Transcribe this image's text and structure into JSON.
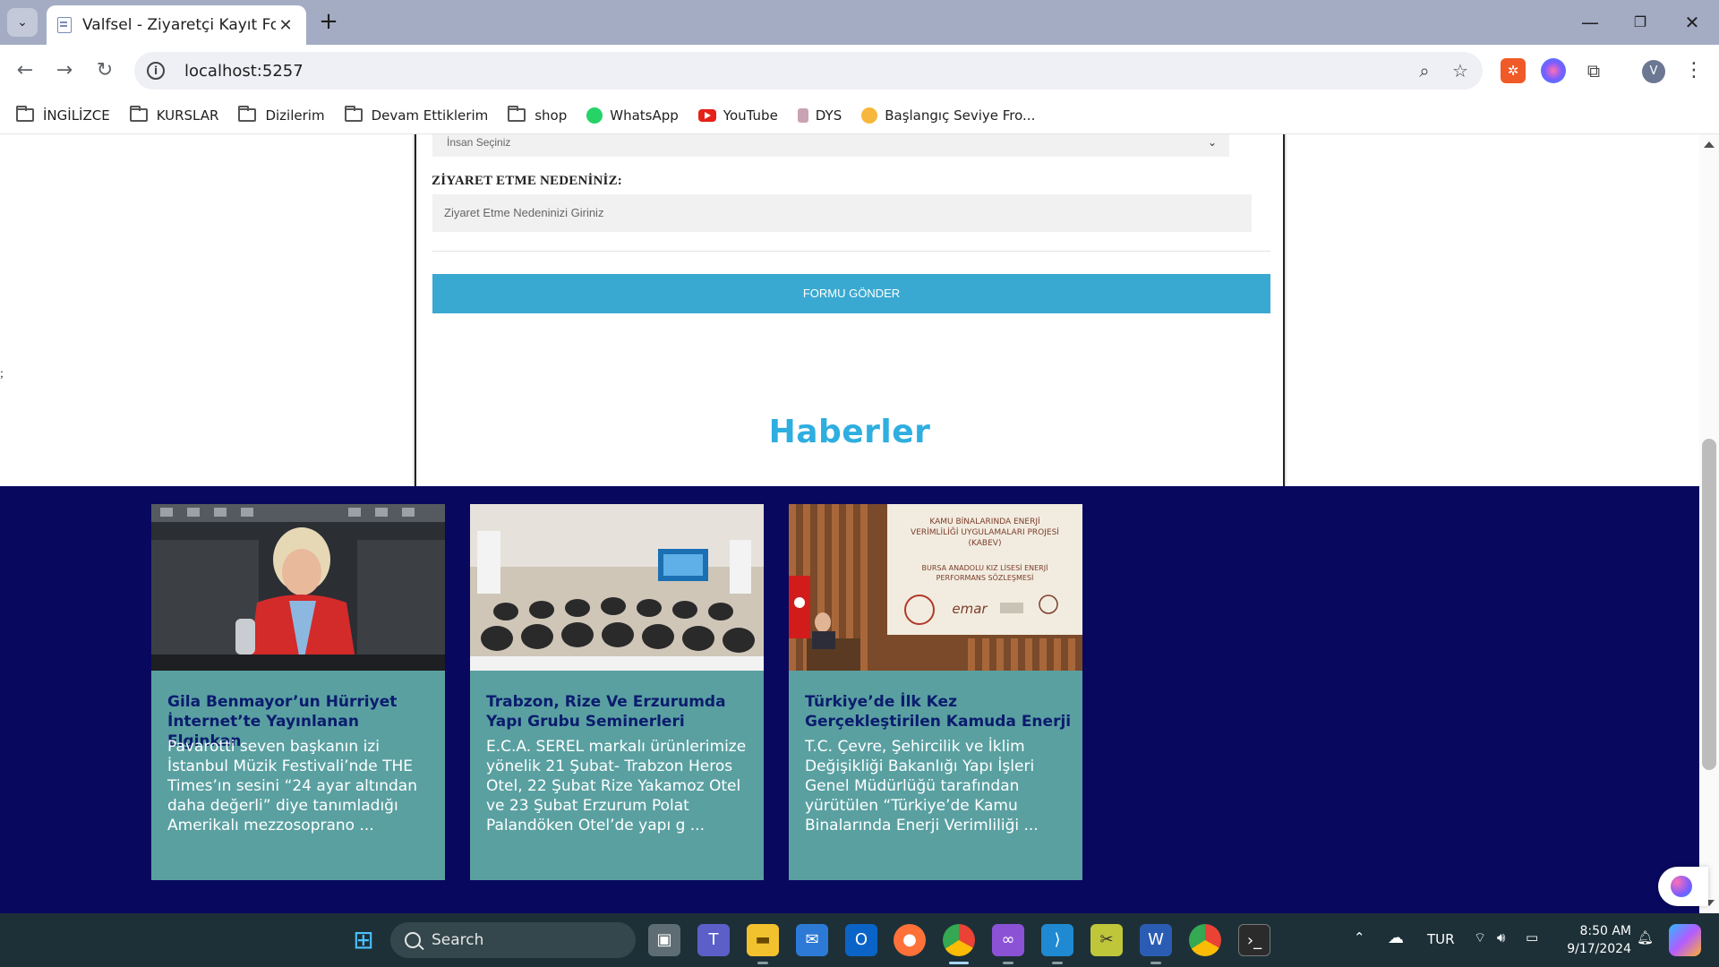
{
  "browser": {
    "tab_title": "Valfsel - Ziyaretçi Kayıt Formu",
    "url": "localhost:5257",
    "bookmarks": [
      {
        "label": "İNGİLİZCE",
        "icon": "folder-icon"
      },
      {
        "label": "KURSLAR",
        "icon": "folder-icon"
      },
      {
        "label": "Dizilerim",
        "icon": "folder-icon"
      },
      {
        "label": "Devam Ettiklerim",
        "icon": "folder-icon"
      },
      {
        "label": "shop",
        "icon": "folder-icon"
      },
      {
        "label": "WhatsApp",
        "icon": "whatsapp-icon"
      },
      {
        "label": "YouTube",
        "icon": "youtube-icon"
      },
      {
        "label": "DYS",
        "icon": "dys-icon"
      },
      {
        "label": "Başlangıç Seviye Fro...",
        "icon": "site-icon"
      }
    ],
    "avatar_letter": "V"
  },
  "form": {
    "select_placeholder": "İnsan Seçiniz",
    "reason_label": "ZİYARET ETME NEDENİNİZ:",
    "reason_placeholder": "Ziyaret Etme Nedeninizi Giriniz",
    "submit_label": "FORMU GÖNDER"
  },
  "page": {
    "stray_text": ";",
    "news_heading": "Haberler"
  },
  "news": [
    {
      "title": "Gila Benmayor’un Hürriyet İnternet’te Yayınlanan Elginkan",
      "text": "Pavarotti seven başkanın izi İstanbul Müzik Festivali’nde THE Times’ın sesini “24 ayar altından daha değerli” diye tanımladığı Amerikalı mezzosoprano ..."
    },
    {
      "title": "Trabzon, Rize Ve Erzurumda Yapı Grubu Seminerleri",
      "text": "E.C.A. SEREL markalı ürünlerimize yönelik 21 Şubat- Trabzon Heros Otel, 22 Şubat Rize Yakamoz Otel ve 23 Şubat Erzurum Polat Palandöken Otel’de yapı g ..."
    },
    {
      "title": "Türkiye’de İlk Kez Gerçekleştirilen Kamuda Enerji",
      "text": "T.C. Çevre, Şehircilik ve İklim Değişikliği Bakanlığı Yapı İşleri Genel Müdürlüğü tarafından yürütülen “Türkiye’de Kamu Binalarında Enerji Verimliliği ..."
    }
  ],
  "news_image3_banner": {
    "line1": "KAMU BİNALARINDA ENERJİ",
    "line2": "VERİMLİLİĞİ UYGULAMALARI PROJESİ",
    "line3": "(KABEV)",
    "line4": "BURSA ANADOLU KIZ LİSESİ ENERJİ",
    "line5": "PERFORMANS SÖZLEŞMESİ",
    "logo": "emar"
  },
  "taskbar": {
    "search_label": "Search",
    "language": "TUR",
    "time": "8:50 AM",
    "date": "9/17/2024"
  },
  "colors": {
    "accent": "#3aa9d1",
    "heading": "#2faee0",
    "news_band": "#08085e",
    "card_bg": "#5aa0a1",
    "card_title": "#0b1c6e"
  }
}
